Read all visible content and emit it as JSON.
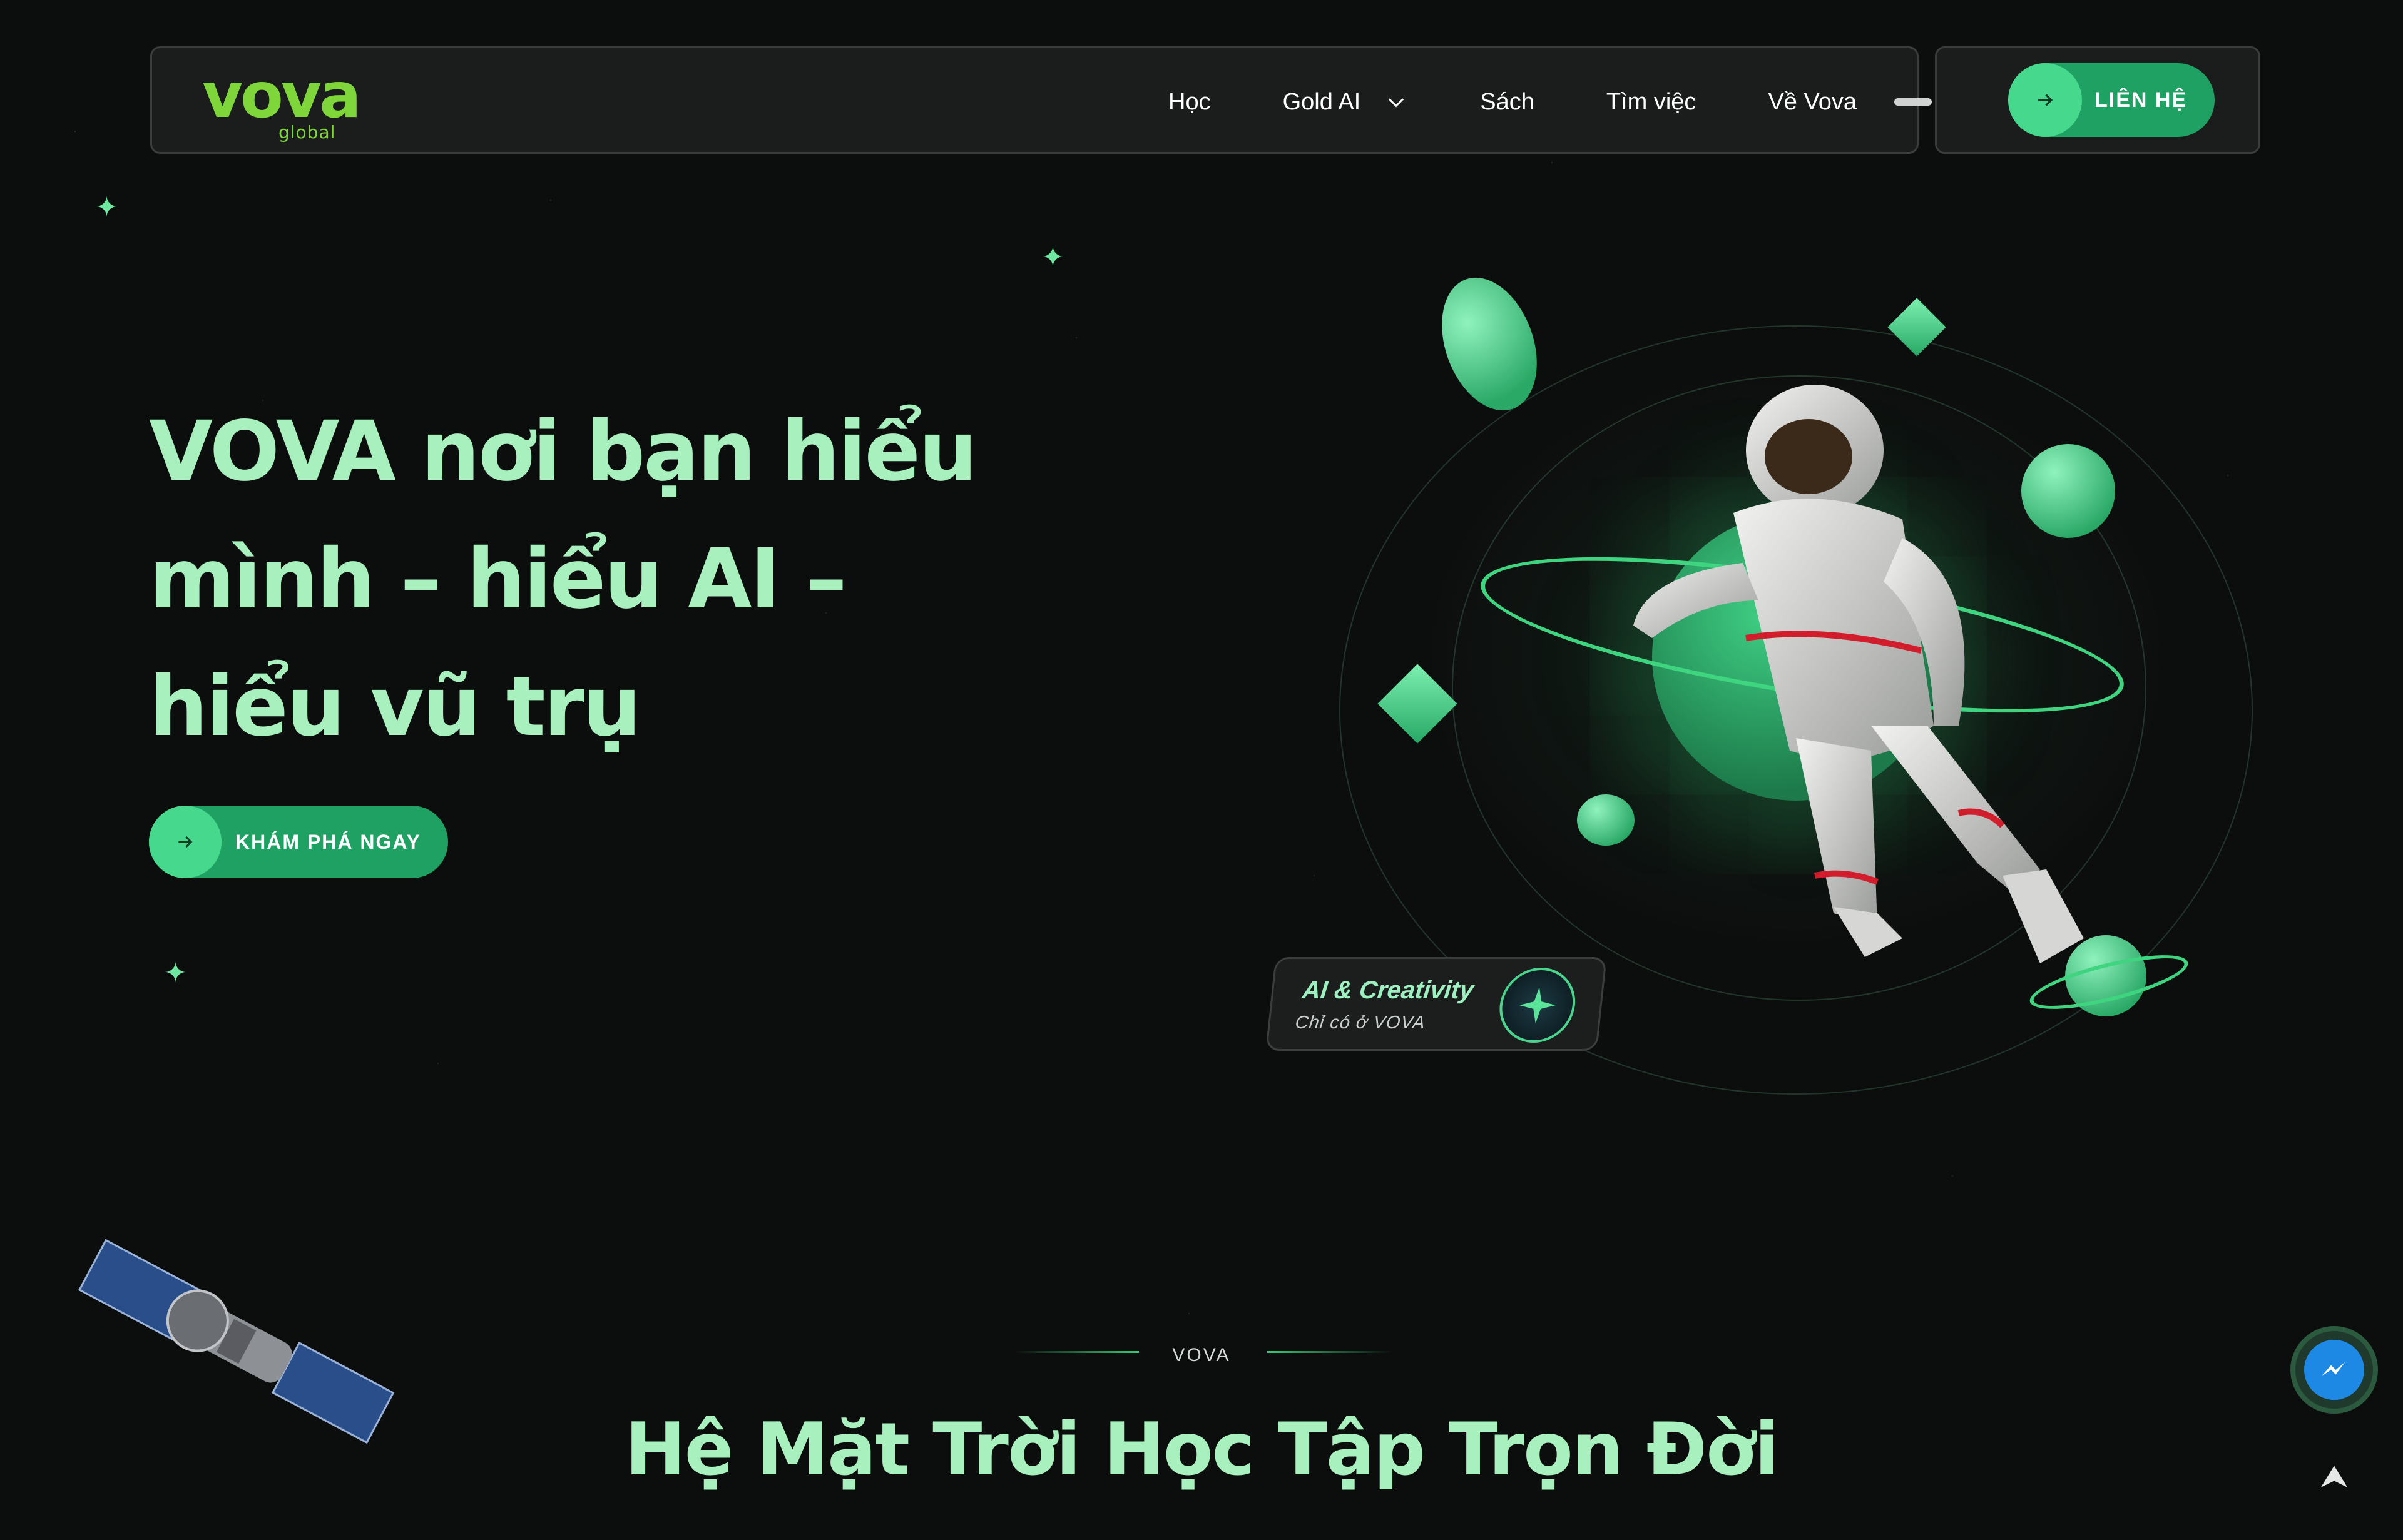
{
  "brand": {
    "logo_main": "vova",
    "logo_sub": "global",
    "accent": "#7fd63a",
    "primary_green": "#1fa163",
    "light_green": "#46d98d",
    "title_color": "#a8f0be"
  },
  "nav": {
    "items": [
      {
        "label": "Học",
        "icon": ""
      },
      {
        "label": "Gold AI",
        "icon": "chevron-down-icon"
      },
      {
        "label": "Sách",
        "icon": ""
      },
      {
        "label": "Tìm việc",
        "icon": ""
      },
      {
        "label": "Về Vova",
        "icon": ""
      }
    ],
    "contact_label": "LIÊN HỆ",
    "contact_icon": "arrow-right-icon"
  },
  "hero": {
    "title": "VOVA nơi bạn hiểu mình – hiểu AI – hiểu vũ trụ",
    "cta_label": "KHÁM PHÁ NGAY",
    "cta_icon": "arrow-right-icon"
  },
  "badge": {
    "title": "AI & Creativity",
    "subtitle": "Chỉ có ở VOVA",
    "icon": "sparkle-icon"
  },
  "section": {
    "kicker": "VOVA",
    "title": "Hệ Mặt Trời Học Tập Trọn Đời"
  },
  "floating": {
    "messenger_icon": "messenger-icon",
    "scroll_top_icon": "arrow-up-icon"
  }
}
